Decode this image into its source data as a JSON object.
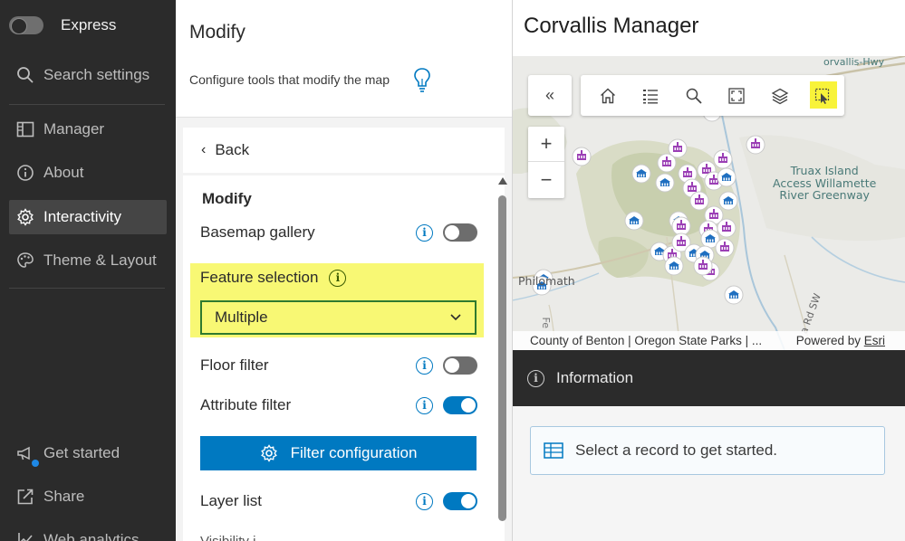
{
  "nav": {
    "express_label": "Express",
    "items": [
      {
        "label": "Search settings"
      },
      {
        "label": "Manager"
      },
      {
        "label": "About"
      },
      {
        "label": "Interactivity"
      },
      {
        "label": "Theme & Layout"
      },
      {
        "label": "Get started"
      },
      {
        "label": "Share"
      },
      {
        "label": "Web analytics"
      }
    ]
  },
  "panel": {
    "title": "Modify",
    "description": "Configure tools that modify the map",
    "back_label": "Back",
    "section_title": "Modify",
    "rows": {
      "basemap_gallery": {
        "label": "Basemap gallery",
        "enabled": false
      },
      "feature_selection": {
        "label": "Feature selection",
        "value": "Multiple"
      },
      "floor_filter": {
        "label": "Floor filter",
        "enabled": false
      },
      "attribute_filter": {
        "label": "Attribute filter",
        "enabled": true
      },
      "filter_config_button": "Filter configuration",
      "layer_list": {
        "label": "Layer list",
        "enabled": true
      },
      "truncated_next": "Visibility i..."
    }
  },
  "app": {
    "title": "Corvallis Manager",
    "map": {
      "labels": {
        "highway": "orvallis-Hwy",
        "truax": "Truax Island\nAccess Willamette\nRiver Greenway",
        "philomath": "Philomath",
        "fe": "Fe",
        "rd": "a Rd SW"
      },
      "attribution": "County of Benton | Oregon State Parks | ...",
      "powered_by": "Powered by",
      "esri": "Esri"
    },
    "info_label": "Information",
    "record_hint": "Select a record to get started."
  },
  "colors": {
    "accent": "#0079c1",
    "highlight": "#f8f874",
    "nav_bg": "#2b2b2b",
    "marker_purple": "#9b3fb5",
    "marker_blue": "#1f6fc0"
  }
}
